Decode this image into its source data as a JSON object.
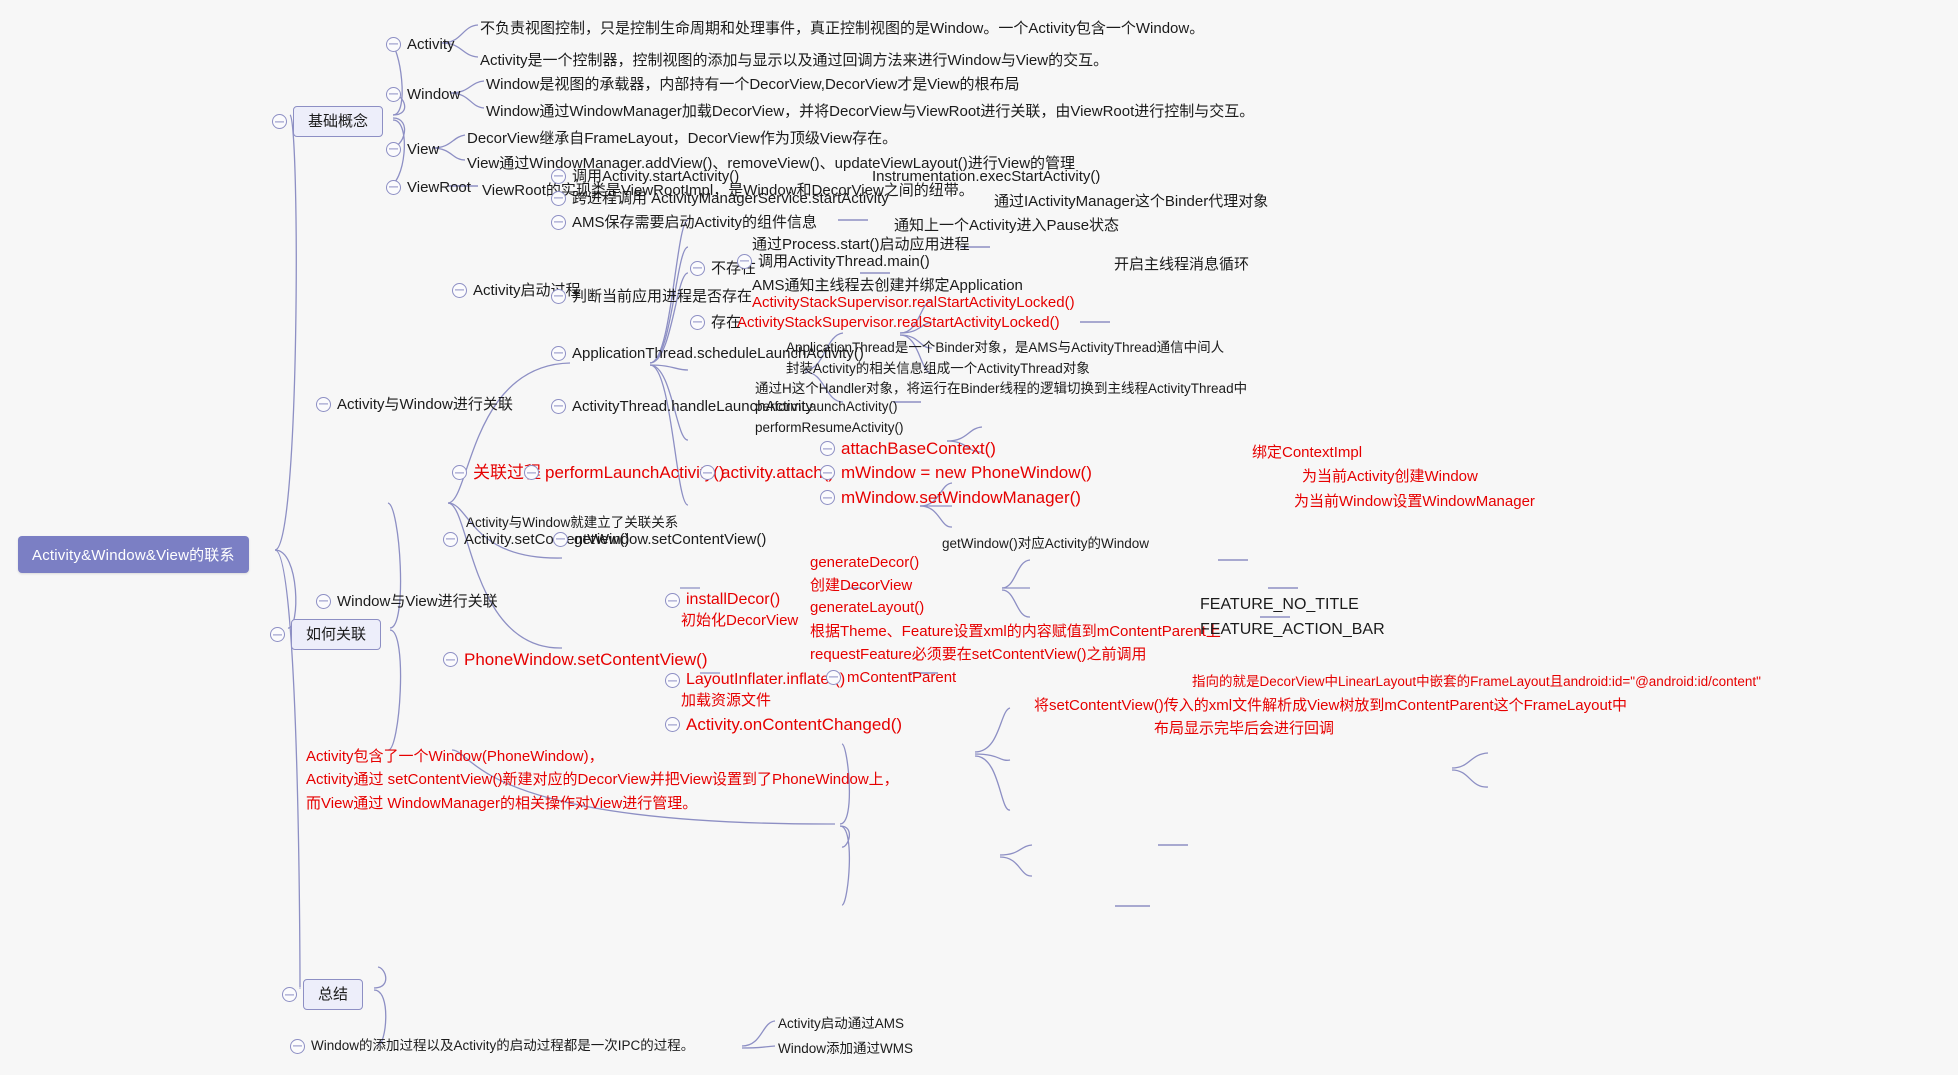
{
  "root": {
    "label": "Activity&Window&View的联系"
  },
  "colors": {
    "branch": "#8d8fc4",
    "root_bg": "#7b7fc4",
    "box_bg": "#edeefa",
    "accent_red": "#e60000",
    "text": "#1b1b1b",
    "page_bg": "#f7f7f7"
  },
  "topics": {
    "basic": "基础概念",
    "how": "如何关联",
    "summary": "总结"
  },
  "basic": {
    "activity": {
      "label": "Activity",
      "d1": "不负责视图控制，只是控制生命周期和处理事件，真正控制视图的是Window。一个Activity包含一个Window。",
      "d2": "Activity是一个控制器，控制视图的添加与显示以及通过回调方法来进行Window与View的交互。"
    },
    "window": {
      "label": "Window",
      "d1": "Window是视图的承载器，内部持有一个DecorView,DecorView才是View的根布局",
      "d2": "Window通过WindowManager加载DecorView，并将DecorView与ViewRoot进行关联，由ViewRoot进行控制与交互。"
    },
    "view": {
      "label": "View",
      "d1": "DecorView继承自FrameLayout，DecorView作为顶级View存在。",
      "d2": "View通过WindowManager.addView()、removeView()、updateViewLayout()进行View的管理"
    },
    "viewroot": {
      "label": "ViewRoot",
      "d1": "ViewRoot的实现类是ViewRootImpl，是Window和DecorView之间的纽带。"
    }
  },
  "how": {
    "activity_window": {
      "label": "Activity与Window进行关联"
    },
    "window_view": {
      "label": "Window与View进行关联"
    },
    "startup": {
      "label": "Activity启动过程",
      "steps": [
        {
          "label": "调用Activity.startActivity()",
          "note": "Instrumentation.execStartActivity()"
        },
        {
          "label": "跨进程调用 ActivityManagerService.startActivity",
          "note": "通过IActivityManager这个Binder代理对象"
        },
        {
          "label": "AMS保存需要启动Activity的组件信息",
          "note": "通知上一个Activity进入Pause状态"
        }
      ],
      "judge": {
        "label": "判断当前应用进程是否存在",
        "not_exist": {
          "label": "不存在",
          "items": [
            {
              "text": "通过Process.start()启动应用进程",
              "red": false,
              "toggle": false,
              "note": ""
            },
            {
              "text": "调用ActivityThread.main()",
              "red": false,
              "toggle": true,
              "note": "开启主线程消息循环"
            },
            {
              "text": "AMS通知主线程去创建并绑定Application",
              "red": false,
              "toggle": false,
              "note": ""
            },
            {
              "text": "ActivityStackSupervisor.realStartActivityLocked()",
              "red": true,
              "toggle": false,
              "note": ""
            }
          ]
        },
        "exist": {
          "label": "存在",
          "note": "ActivityStackSupervisor.realStartActivityLocked()"
        }
      },
      "schedule": {
        "label": "ApplicationThread.scheduleLaunchActivity()",
        "d1": "ApplicationThread是一个Binder对象，是AMS与ActivityThread通信中间人",
        "d2": "封装Activity的相关信息组成一个ActivityThread对象"
      },
      "handle": {
        "label": "ActivityThread.handleLaunchActivity",
        "d1": "通过H这个Handler对象，将运行在Binder线程的逻辑切换到主线程ActivityThread中",
        "d2": "performLaunchActivity()",
        "d3": "performResumeActivity()"
      }
    },
    "relate": {
      "label": "关联过程",
      "perform": "performLaunchActivity()",
      "attach": "activity.attach()",
      "items": [
        {
          "label": "attachBaseContext()",
          "note": "绑定ContextImpl"
        },
        {
          "label": "mWindow = new PhoneWindow()",
          "note": "为当前Activity创建Window"
        },
        {
          "label": "mWindow.setWindowManager()",
          "note": "为当前Window设置WindowManager"
        }
      ],
      "footer": "Activity与Window就建立了关联关系"
    },
    "set_content": {
      "label": "Activity.setContentView()",
      "child": "getWindow.setContentView()",
      "note": "getWindow()对应Activity的Window"
    },
    "phone_window": {
      "label": "PhoneWindow.setContentView()",
      "install_decor": {
        "label": "installDecor()",
        "sub": "初始化DecorView",
        "items": [
          {
            "l1": "generateDecor()",
            "l2": "创建DecorView",
            "note1": "",
            "note2": ""
          },
          {
            "l1": "generateLayout()",
            "l2": "根据Theme、Feature设置xml的内容赋值到mContentParent上",
            "note1": "FEATURE_NO_TITLE",
            "note2": "FEATURE_ACTION_BAR"
          },
          {
            "l1": "requestFeature必须要在setContentView()之前调用",
            "l2": "",
            "note1": "",
            "note2": ""
          }
        ]
      },
      "layout_inflater": {
        "label": "LayoutInflater.inflater()",
        "sub": "加载资源文件",
        "content_parent": "mContentParent",
        "content_parent_note": "指向的就是DecorView中LinearLayout中嵌套的FrameLayout且android:id=\"@android:id/content\"",
        "content_parent_note2": "将setContentView()传入的xml文件解析成View树放到mContentParent这个FrameLayout中"
      },
      "content_changed": {
        "label": "Activity.onContentChanged()",
        "note": "布局显示完毕后会进行回调"
      }
    }
  },
  "summary": {
    "red_lines": "Activity包含了一个Window(PhoneWindow)，\nActivity通过 setContentView()新建对应的DecorView并把View设置到了PhoneWindow上，\n而View通过 WindowManager的相关操作对View进行管理。",
    "ipc": "Window的添加过程以及Activity的启动过程都是一次IPC的过程。",
    "ipc_children": [
      "Activity启动通过AMS",
      "Window添加通过WMS"
    ]
  }
}
